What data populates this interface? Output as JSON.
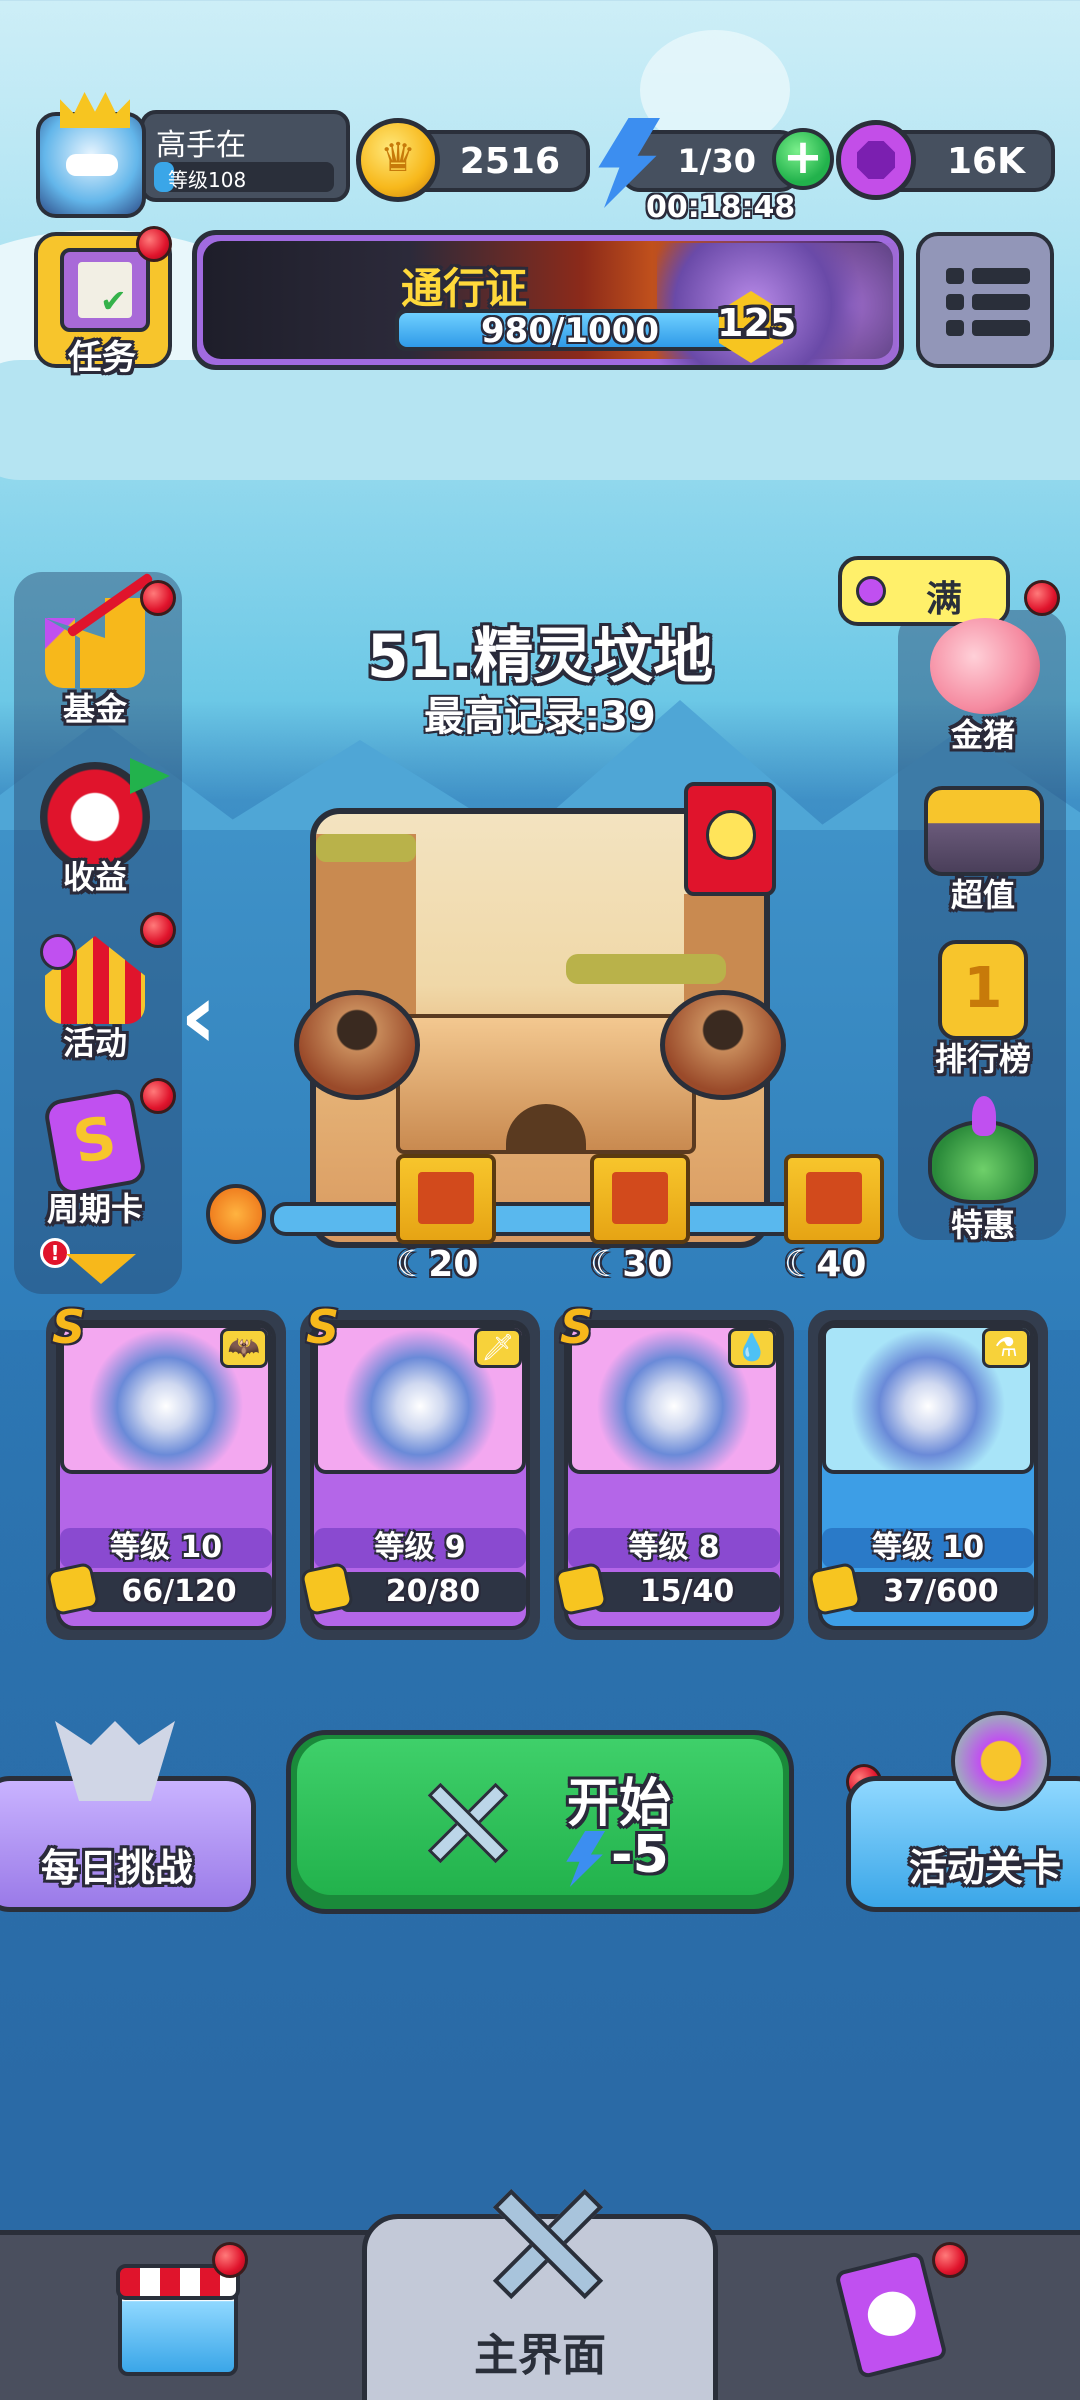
{
  "player": {
    "name": "高手在",
    "level_label": "等级108"
  },
  "currency": {
    "gold": "2516",
    "energy": "1/30",
    "energy_timer": "00:18:48",
    "gems": "16K"
  },
  "tasks": {
    "label": "任务"
  },
  "pass": {
    "title": "通行证",
    "progress": "980/1000",
    "progress_fraction": 0.98,
    "level": "125"
  },
  "left_menu": [
    {
      "label": "基金",
      "icon": "fund-icon"
    },
    {
      "label": "收益",
      "icon": "earnings-icon"
    },
    {
      "label": "活动",
      "icon": "event-tent-icon"
    },
    {
      "label": "周期卡",
      "icon": "period-card-icon"
    }
  ],
  "right_menu": [
    {
      "label": "金猪",
      "icon": "golden-pig-icon"
    },
    {
      "label": "超值",
      "icon": "value-chest-icon"
    },
    {
      "label": "排行榜",
      "icon": "leaderboard-icon"
    },
    {
      "label": "特惠",
      "icon": "special-offer-icon"
    }
  ],
  "pig_badge": "满",
  "stage": {
    "title": "51.精灵坟地",
    "best": "最高记录:39"
  },
  "rewards": [
    {
      "days": "20"
    },
    {
      "days": "30"
    },
    {
      "days": "40"
    }
  ],
  "heroes": [
    {
      "rank": "S",
      "level": "等级 10",
      "shards": "66/120",
      "elem": "🦇",
      "color": "#b466e8",
      "portrait": "#f3a8f0"
    },
    {
      "rank": "S",
      "level": "等级 9",
      "shards": "20/80",
      "elem": "🗡",
      "color": "#b466e8",
      "portrait": "#f3a8f0"
    },
    {
      "rank": "S",
      "level": "等级 8",
      "shards": "15/40",
      "elem": "💧",
      "color": "#b466e8",
      "portrait": "#f3a8f0"
    },
    {
      "rank": "",
      "level": "等级 10",
      "shards": "37/600",
      "elem": "⚗",
      "color": "#3d9ee6",
      "portrait": "#a8e4f8"
    }
  ],
  "buttons": {
    "daily": "每日挑战",
    "start": "开始",
    "start_cost": "-5",
    "event_stage": "活动关卡"
  },
  "bottom_nav": {
    "main": "主界面"
  },
  "colors": {
    "accent_green": "#22b24c",
    "purple": "#a98ef0",
    "blue": "#3aa6e8"
  }
}
